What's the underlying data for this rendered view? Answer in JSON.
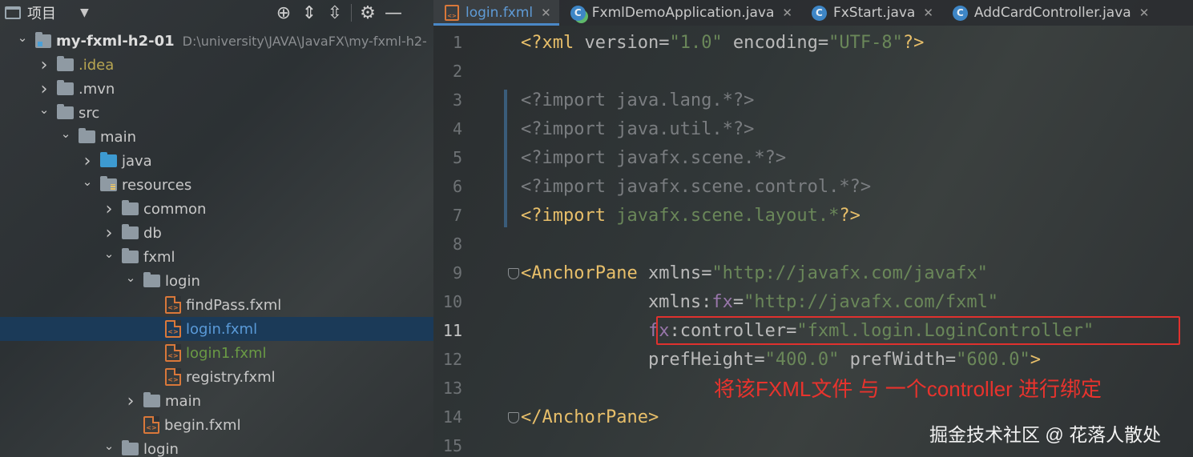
{
  "project_panel": {
    "title": "项目",
    "tree": [
      {
        "label": "my-fxml-h2-01",
        "path": "D:\\university\\JAVA\\JavaFX\\my-fxml-h2-",
        "indent": 0,
        "arrow": "down",
        "icon": "module-folder",
        "style": "bold"
      },
      {
        "label": ".idea",
        "indent": 1,
        "arrow": "right",
        "icon": "folder",
        "style": "yellow"
      },
      {
        "label": ".mvn",
        "indent": 1,
        "arrow": "right",
        "icon": "folder",
        "style": "normal"
      },
      {
        "label": "src",
        "indent": 1,
        "arrow": "down",
        "icon": "folder",
        "style": "normal"
      },
      {
        "label": "main",
        "indent": 2,
        "arrow": "down",
        "icon": "folder",
        "style": "normal"
      },
      {
        "label": "java",
        "indent": 3,
        "arrow": "right",
        "icon": "source-folder",
        "style": "normal"
      },
      {
        "label": "resources",
        "indent": 3,
        "arrow": "down",
        "icon": "resources-folder",
        "style": "normal"
      },
      {
        "label": "common",
        "indent": 4,
        "arrow": "right",
        "icon": "folder",
        "style": "normal"
      },
      {
        "label": "db",
        "indent": 4,
        "arrow": "right",
        "icon": "folder",
        "style": "normal"
      },
      {
        "label": "fxml",
        "indent": 4,
        "arrow": "down",
        "icon": "folder",
        "style": "normal"
      },
      {
        "label": "login",
        "indent": 5,
        "arrow": "down",
        "icon": "folder",
        "style": "normal"
      },
      {
        "label": "findPass.fxml",
        "indent": 6,
        "arrow": "none",
        "icon": "fxml-file",
        "style": "normal"
      },
      {
        "label": "login.fxml",
        "indent": 6,
        "arrow": "none",
        "icon": "fxml-file",
        "style": "blue",
        "selected": true
      },
      {
        "label": "login1.fxml",
        "indent": 6,
        "arrow": "none",
        "icon": "fxml-file",
        "style": "green"
      },
      {
        "label": "registry.fxml",
        "indent": 6,
        "arrow": "none",
        "icon": "fxml-file",
        "style": "normal"
      },
      {
        "label": "main",
        "indent": 5,
        "arrow": "right",
        "icon": "folder",
        "style": "normal"
      },
      {
        "label": "begin.fxml",
        "indent": 5,
        "arrow": "none",
        "icon": "fxml-file",
        "style": "normal"
      },
      {
        "label": "login",
        "indent": 4,
        "arrow": "down",
        "icon": "folder",
        "style": "normal"
      }
    ]
  },
  "tabs": [
    {
      "label": "login.fxml",
      "icon": "fxml",
      "active": true
    },
    {
      "label": "FxmlDemoApplication.java",
      "icon": "app-class",
      "active": false
    },
    {
      "label": "FxStart.java",
      "icon": "class",
      "active": false
    },
    {
      "label": "AddCardController.java",
      "icon": "class",
      "active": false
    }
  ],
  "editor": {
    "current_line": 11,
    "lines": [
      {
        "n": "1",
        "tokens": [
          [
            "<?",
            "pi"
          ],
          [
            "xml ",
            "pi"
          ],
          [
            "version",
            "attr"
          ],
          [
            "=",
            "attr"
          ],
          [
            "\"1.0\"",
            "str"
          ],
          [
            " encoding",
            "attr"
          ],
          [
            "=",
            "attr"
          ],
          [
            "\"UTF-8\"",
            "str"
          ],
          [
            "?>",
            "pi"
          ]
        ]
      },
      {
        "n": "2",
        "tokens": []
      },
      {
        "n": "3",
        "tokens": [
          [
            "<?import java.lang.*?>",
            "gray"
          ]
        ]
      },
      {
        "n": "4",
        "tokens": [
          [
            "<?import java.util.*?>",
            "gray"
          ]
        ]
      },
      {
        "n": "5",
        "tokens": [
          [
            "<?import javafx.scene.*?>",
            "gray"
          ]
        ]
      },
      {
        "n": "6",
        "tokens": [
          [
            "<?import javafx.scene.control.*?>",
            "gray"
          ]
        ]
      },
      {
        "n": "7",
        "tokens": [
          [
            "<?import ",
            "pi"
          ],
          [
            "javafx.scene.layout.*",
            "str"
          ],
          [
            "?>",
            "pi"
          ]
        ]
      },
      {
        "n": "8",
        "tokens": []
      },
      {
        "n": "9",
        "tokens": [
          [
            "<AnchorPane",
            "tag"
          ],
          [
            " xmlns",
            "attr"
          ],
          [
            "=",
            "attr"
          ],
          [
            "\"http://javafx.com/javafx\"",
            "str"
          ]
        ]
      },
      {
        "n": "10",
        "tokens": [
          [
            "            xmlns",
            "attr"
          ],
          [
            ":",
            "attr"
          ],
          [
            "fx",
            "ns"
          ],
          [
            "=",
            "attr"
          ],
          [
            "\"http://javafx.com/fxml\"",
            "str"
          ]
        ]
      },
      {
        "n": "11",
        "tokens": [
          [
            "            ",
            "attr"
          ],
          [
            "fx",
            "ns"
          ],
          [
            ":controller",
            "attr"
          ],
          [
            "=",
            "attr"
          ],
          [
            "\"fxml.login.LoginController\"",
            "str"
          ]
        ]
      },
      {
        "n": "12",
        "tokens": [
          [
            "            prefHeight",
            "attr"
          ],
          [
            "=",
            "attr"
          ],
          [
            "\"400.0\"",
            "str"
          ],
          [
            " prefWidth",
            "attr"
          ],
          [
            "=",
            "attr"
          ],
          [
            "\"600.0\"",
            "str"
          ],
          [
            ">",
            "tag"
          ]
        ]
      },
      {
        "n": "13",
        "tokens": []
      },
      {
        "n": "14",
        "tokens": [
          [
            "</AnchorPane>",
            "tag"
          ]
        ]
      },
      {
        "n": "15",
        "tokens": []
      }
    ]
  },
  "annotation": "将该FXML文件 与 一个controller 进行绑定",
  "watermark": "掘金技术社区 @ 花落人散处",
  "colors": {
    "annotation_red": "#e0312e",
    "selected_row": "#1b3a58",
    "tab_accent": "#4a88c7"
  }
}
